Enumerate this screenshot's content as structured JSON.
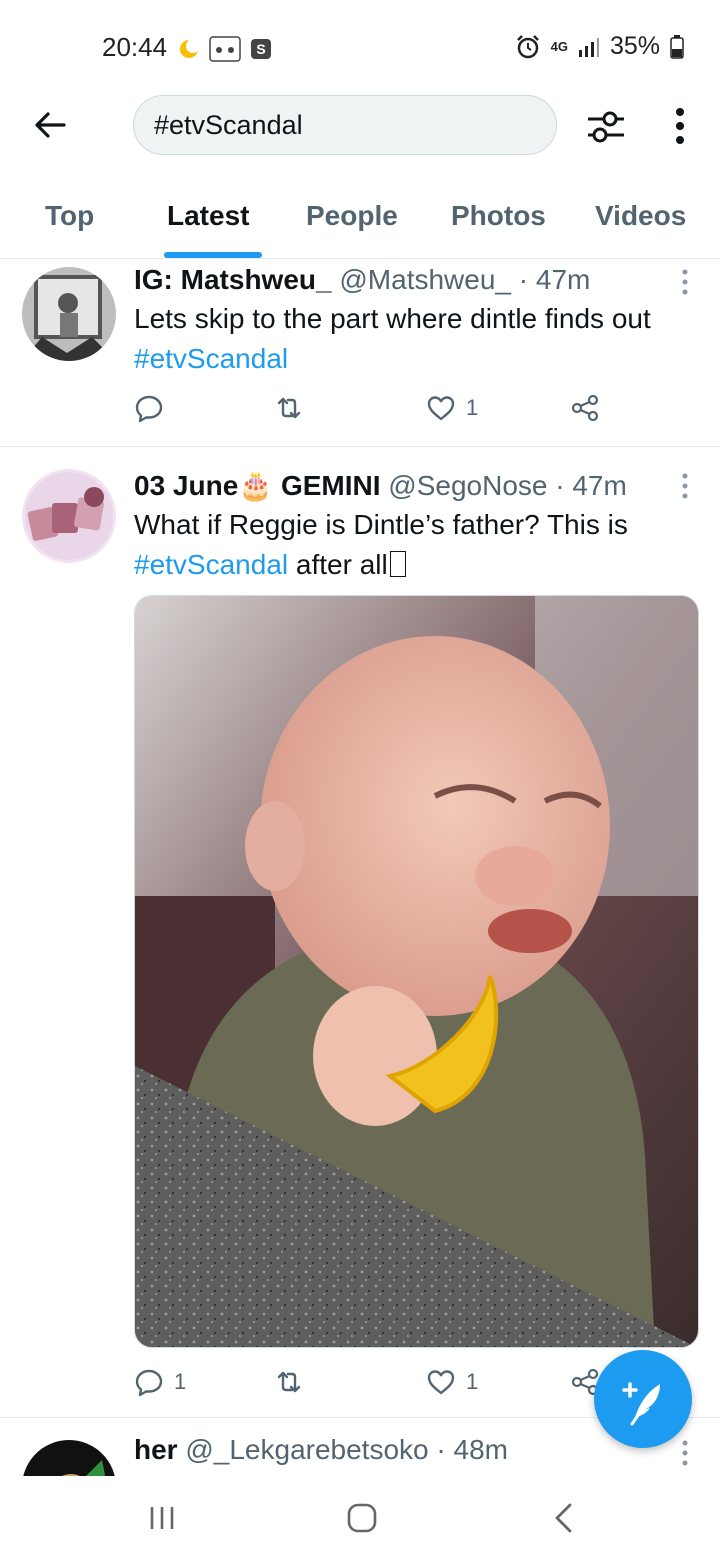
{
  "status_bar": {
    "time": "20:44",
    "network": "4G",
    "battery": "35%"
  },
  "search": {
    "query": "#etvScandal"
  },
  "tabs": [
    {
      "label": "Top",
      "active": false
    },
    {
      "label": "Latest",
      "active": true
    },
    {
      "label": "People",
      "active": false
    },
    {
      "label": "Photos",
      "active": false
    },
    {
      "label": "Videos",
      "active": false
    }
  ],
  "tweets": [
    {
      "name": "IG: Matshweu_",
      "handle": "@Matshweu_",
      "time": "· 47m",
      "text": "Lets skip to the part where dintle finds out ",
      "hashtag": "#etvScandal",
      "replies": "",
      "likes": "1"
    },
    {
      "name_prefix": "03 June",
      "name_emoji": "🎂",
      "name_suffix": "GEMINI",
      "handle": "@SegoNose",
      "time": "· 47m",
      "text_line1": "What if Reggie is Dintle’s father? This is",
      "hashtag": "#etvScandal",
      "text_tail": " after all",
      "replies": "1",
      "likes": "1"
    },
    {
      "name": "her",
      "handle": "@_Lekgarebetsoko",
      "time": "· 48m"
    }
  ],
  "colors": {
    "accent": "#1d9bf0",
    "muted": "#536471",
    "text": "#0f1419"
  }
}
